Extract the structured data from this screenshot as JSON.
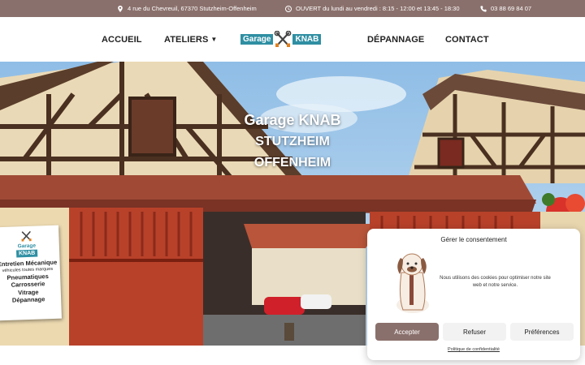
{
  "topbar": {
    "address": "4 rue du Chevreuil, 67370 Stutzheim-Offenheim",
    "hours": "OUVERT du lundi au vendredi : 8:15 - 12:00 et 13:45 - 18:30",
    "phone": "03 88 69 84 07",
    "background": "#8a706c"
  },
  "nav": {
    "accueil": "ACCUEIL",
    "ateliers": "ATELIERS",
    "depannage": "DÉPANNAGE",
    "contact": "CONTACT"
  },
  "logo": {
    "left_word": "Garage",
    "right_word": "KNAB",
    "color": "#2f8fa3"
  },
  "hero": {
    "line1": "Garage KNAB",
    "line2": "STUTZHEIM",
    "line3": "OFFENHEIM"
  },
  "badge": {
    "logo_top": "Garage",
    "logo_bottom": "KNAB",
    "services": [
      "Entretien Mécanique",
      "véhicules toutes marques",
      "Pneumatiques",
      "Carrosserie",
      "Vitrage",
      "Dépannage"
    ]
  },
  "cookie": {
    "title": "Gérer le consentement",
    "message": "Nous utilisons des cookies pour optimiser notre site web et notre service.",
    "accept": "Accepter",
    "refuse": "Refuser",
    "preferences": "Préférences",
    "policy": "Politique de confidentialité",
    "accent": "#8a706c"
  },
  "icons": {
    "address": "map-pin-icon",
    "hours": "clock-icon",
    "phone": "phone-icon",
    "dropdown": "chevron-down-icon"
  }
}
